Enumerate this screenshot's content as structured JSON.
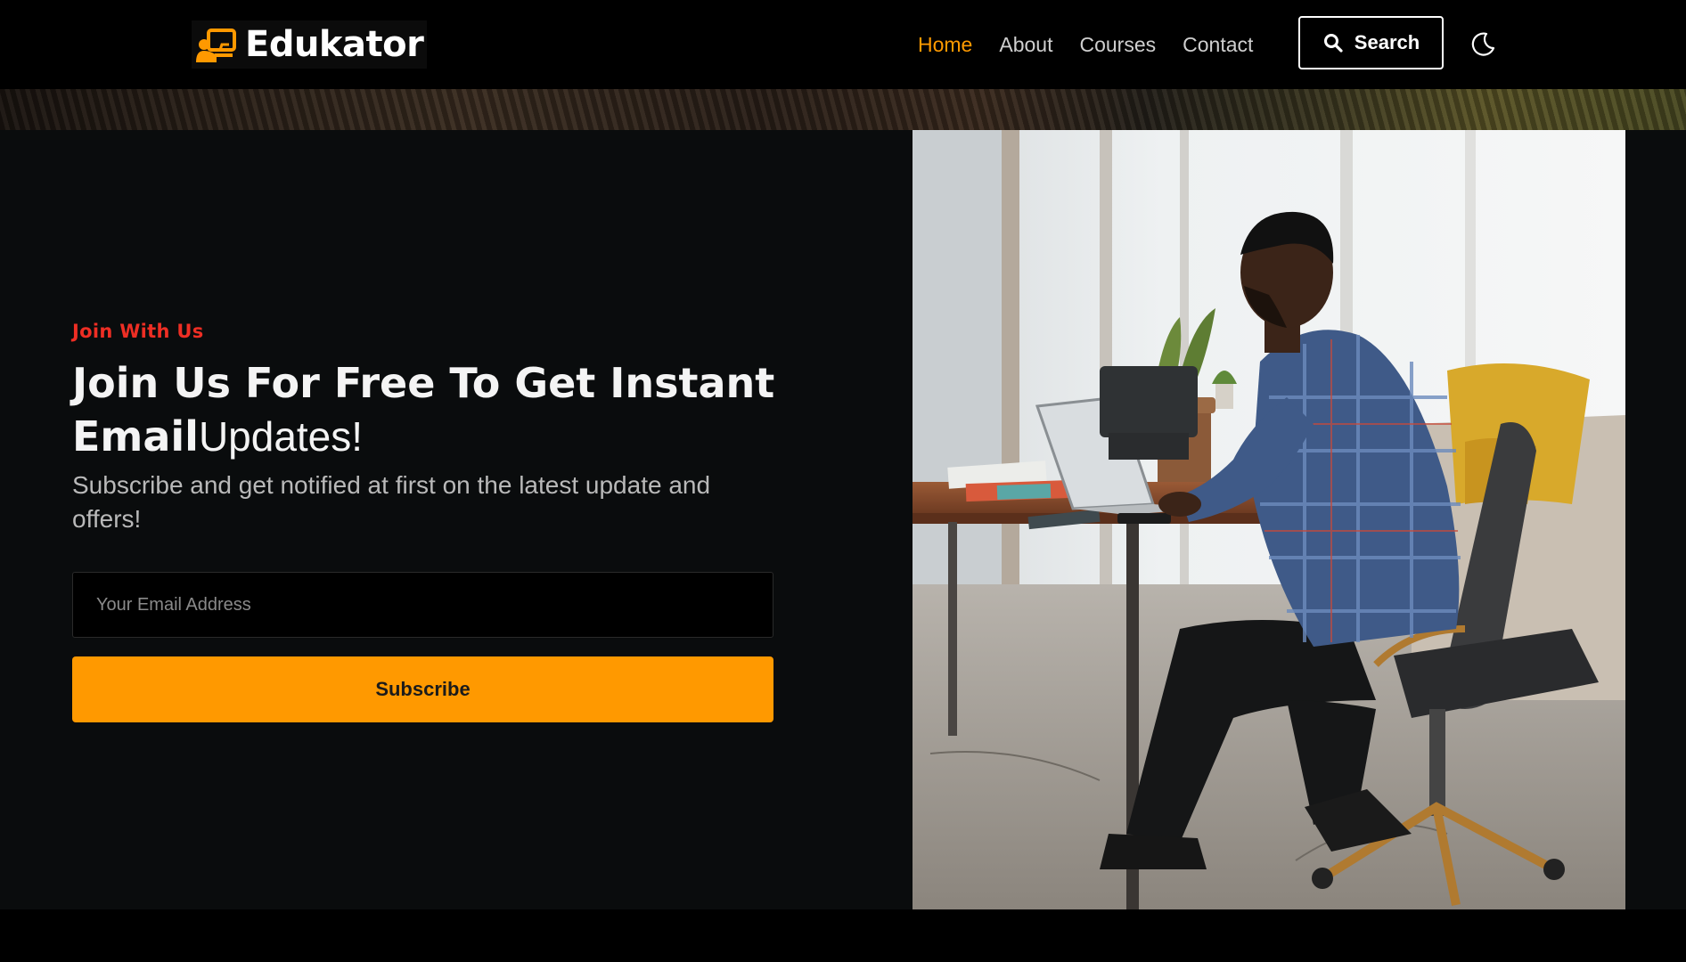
{
  "brand": {
    "name": "Edukator",
    "accent": "#ff9900"
  },
  "nav": {
    "items": [
      {
        "label": "Home",
        "active": true
      },
      {
        "label": "About",
        "active": false
      },
      {
        "label": "Courses",
        "active": false
      },
      {
        "label": "Contact",
        "active": false
      }
    ],
    "search_label": "Search",
    "search_icon": "search-icon",
    "theme_icon": "moon-icon"
  },
  "signup": {
    "eyebrow": "Join With Us",
    "headline_bold": "Join Us For Free To Get Instant Email",
    "headline_regular": "Updates!",
    "subtext": "Subscribe and get notified at first on the latest update and offers!",
    "email_placeholder": "Your Email Address",
    "email_value": "",
    "subscribe_label": "Subscribe"
  },
  "colors": {
    "eyebrow": "#ee2e24",
    "nav_active": "#ff9a00",
    "section_bg": "#0a0c0d",
    "button_bg": "#ff9900"
  }
}
